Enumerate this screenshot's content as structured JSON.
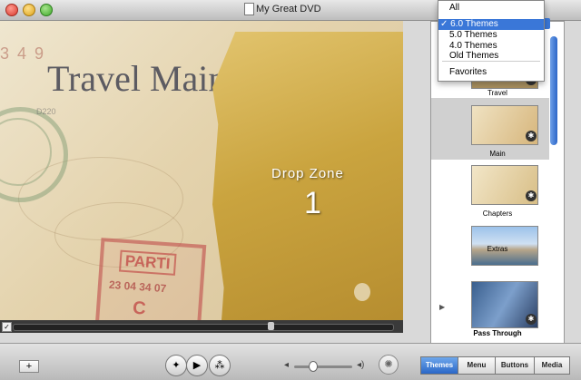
{
  "window": {
    "title": "My Great DVD"
  },
  "preview": {
    "menu_title": "Travel Main",
    "drop_zone_label": "Drop Zone",
    "drop_zone_number": "1",
    "stamp_numbers": "3 4 9",
    "stamp_d": "D220",
    "parti_label": "PARTI",
    "parti_date": "23 04 34 07",
    "parti_letter": "C"
  },
  "theme_menu": {
    "items": [
      {
        "label": "All",
        "selected": false
      },
      {
        "label": "✓ 6.0 Themes",
        "selected": true
      },
      {
        "label": "5.0 Themes",
        "selected": false
      },
      {
        "label": "4.0 Themes",
        "selected": false
      },
      {
        "label": "Old Themes",
        "selected": false
      },
      {
        "label": "Favorites",
        "selected": false
      }
    ]
  },
  "theme_list": {
    "items": [
      {
        "label": "Travel"
      },
      {
        "label": "Main"
      },
      {
        "label": "Chapters"
      },
      {
        "label": "Extras"
      },
      {
        "label": "Pass Through"
      }
    ]
  },
  "toolbar": {
    "add_label": "+",
    "tabs": [
      {
        "label": "Themes",
        "active": true
      },
      {
        "label": "Menu",
        "active": false
      },
      {
        "label": "Buttons",
        "active": false
      },
      {
        "label": "Media",
        "active": false
      }
    ]
  },
  "colors": {
    "accent": "#3a77d8",
    "dropzone": "#caa43f"
  }
}
